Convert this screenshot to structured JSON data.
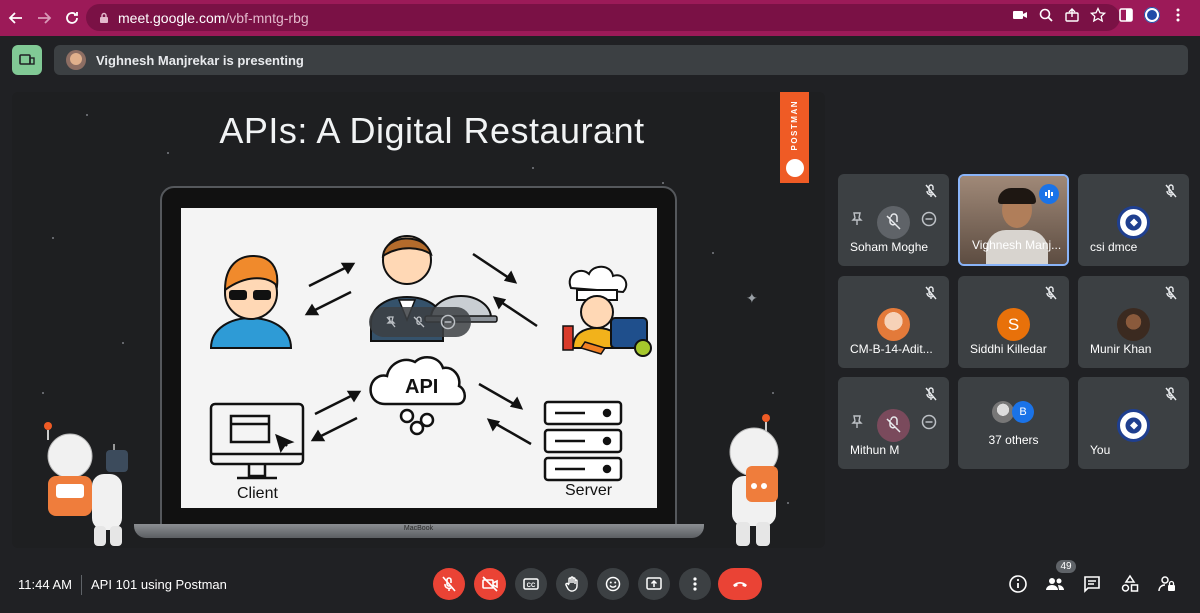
{
  "browser": {
    "url_host": "meet.google.com",
    "url_path": "/vbf-mntg-rbg",
    "theme_color": "#9c1a58"
  },
  "presenting": {
    "text": "Vighnesh Manjrekar is presenting"
  },
  "slide": {
    "title": "APIs: A Digital Restaurant",
    "brand": "POSTMAN",
    "client_label": "Client",
    "server_label": "Server",
    "api_label": "API",
    "laptop_label": "MacBook"
  },
  "participants": [
    {
      "name": "Soham Moghe",
      "muted": true,
      "pinnable": true
    },
    {
      "name": "Vighnesh Manj...",
      "speaking": true
    },
    {
      "name": "csi dmce",
      "muted": true
    },
    {
      "name": "CM-B-14-Adit...",
      "muted": true
    },
    {
      "name": "Siddhi Killedar",
      "muted": true,
      "initial": "S",
      "avatar_color": "#e8710a"
    },
    {
      "name": "Munir Khan",
      "muted": true
    },
    {
      "name": "Mithun M",
      "muted": true,
      "pinnable": true
    },
    {
      "name": "37 others",
      "others_initial": "B"
    },
    {
      "name": "You",
      "muted": true
    }
  ],
  "meeting": {
    "time": "11:44 AM",
    "title": "API 101 using Postman",
    "people_count": "49"
  },
  "colors": {
    "accent_blue": "#8ab4f8",
    "danger_red": "#ea4335",
    "tile_bg": "#3c4043"
  }
}
